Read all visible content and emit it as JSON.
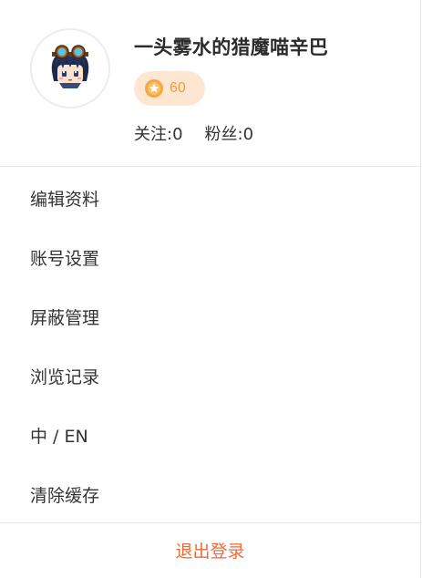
{
  "profile": {
    "username": "一头雾水的猎魔喵辛巴",
    "level": "60",
    "following": "关注:0",
    "followers": "粉丝:0",
    "badge_color": "#fde7d3",
    "badge_text_color": "#f39a3d"
  },
  "menu": {
    "items": [
      {
        "label": "编辑资料"
      },
      {
        "label": "账号设置"
      },
      {
        "label": "屏蔽管理"
      },
      {
        "label": "浏览记录"
      },
      {
        "label": "中 / EN"
      },
      {
        "label": "清除缓存"
      }
    ]
  },
  "logout": {
    "label": "退出登录",
    "color": "#f06a35"
  }
}
